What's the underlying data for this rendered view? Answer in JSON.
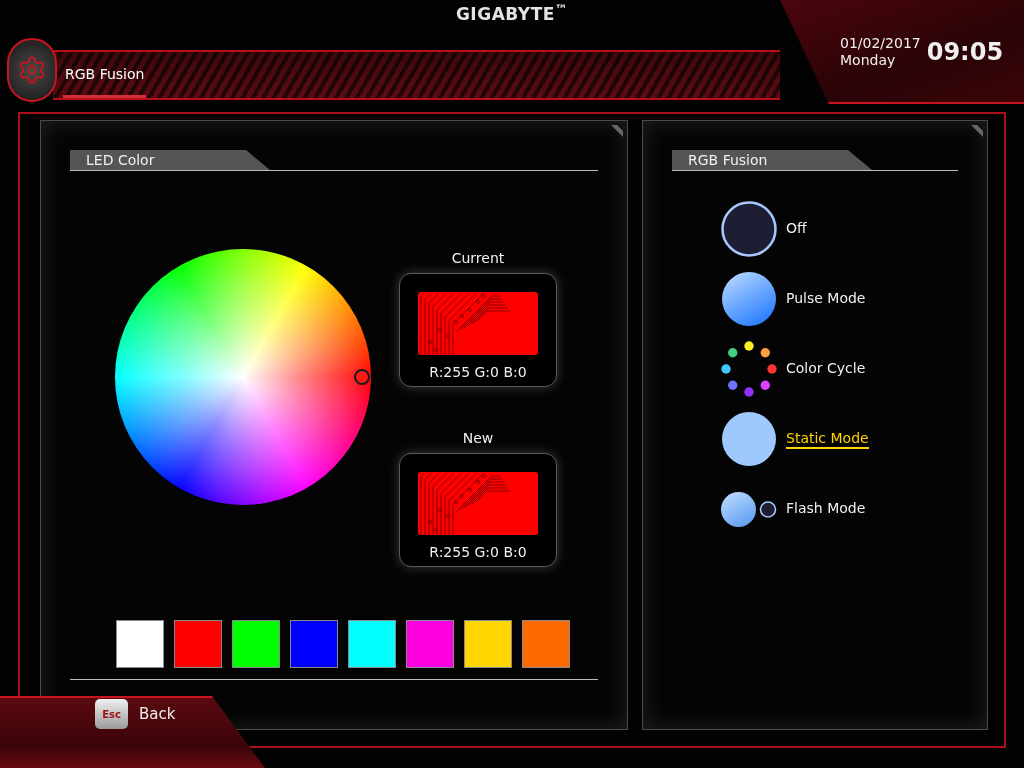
{
  "header": {
    "logo": "GIGABYTE$^{™}$",
    "tabs": [
      {
        "label": "RGB Fusion",
        "selected": true
      }
    ],
    "date": "01/02/2017",
    "day": "Monday",
    "time": "09:05"
  },
  "led_color": {
    "title": "LED Color",
    "previews": [
      {
        "label": "Current",
        "reading": "R:255 G:0 B:0"
      },
      {
        "label": "New",
        "reading": "R:255 G:0 B:0"
      }
    ],
    "swatches": [
      {
        "color": "#ffffff"
      },
      {
        "color": "#ff0000"
      },
      {
        "color": "#00ff00"
      },
      {
        "color": "#0000ff"
      },
      {
        "color": "#00ffff"
      },
      {
        "color": "#ff00e0"
      },
      {
        "color": "#ffd700"
      },
      {
        "color": "#ff6a00"
      }
    ]
  },
  "rgb_fusion": {
    "title": "RGB Fusion",
    "modes": [
      {
        "kind": "off",
        "label": "Off",
        "selected": false
      },
      {
        "kind": "pulse",
        "label": "Pulse Mode",
        "selected": false
      },
      {
        "kind": "cycle",
        "label": "Color Cycle",
        "selected": false
      },
      {
        "kind": "static",
        "label": "Static Mode",
        "selected": true
      },
      {
        "kind": "flash",
        "label": "Flash Mode",
        "selected": false
      }
    ]
  },
  "footer": {
    "key": "Esc",
    "label": "Back"
  }
}
